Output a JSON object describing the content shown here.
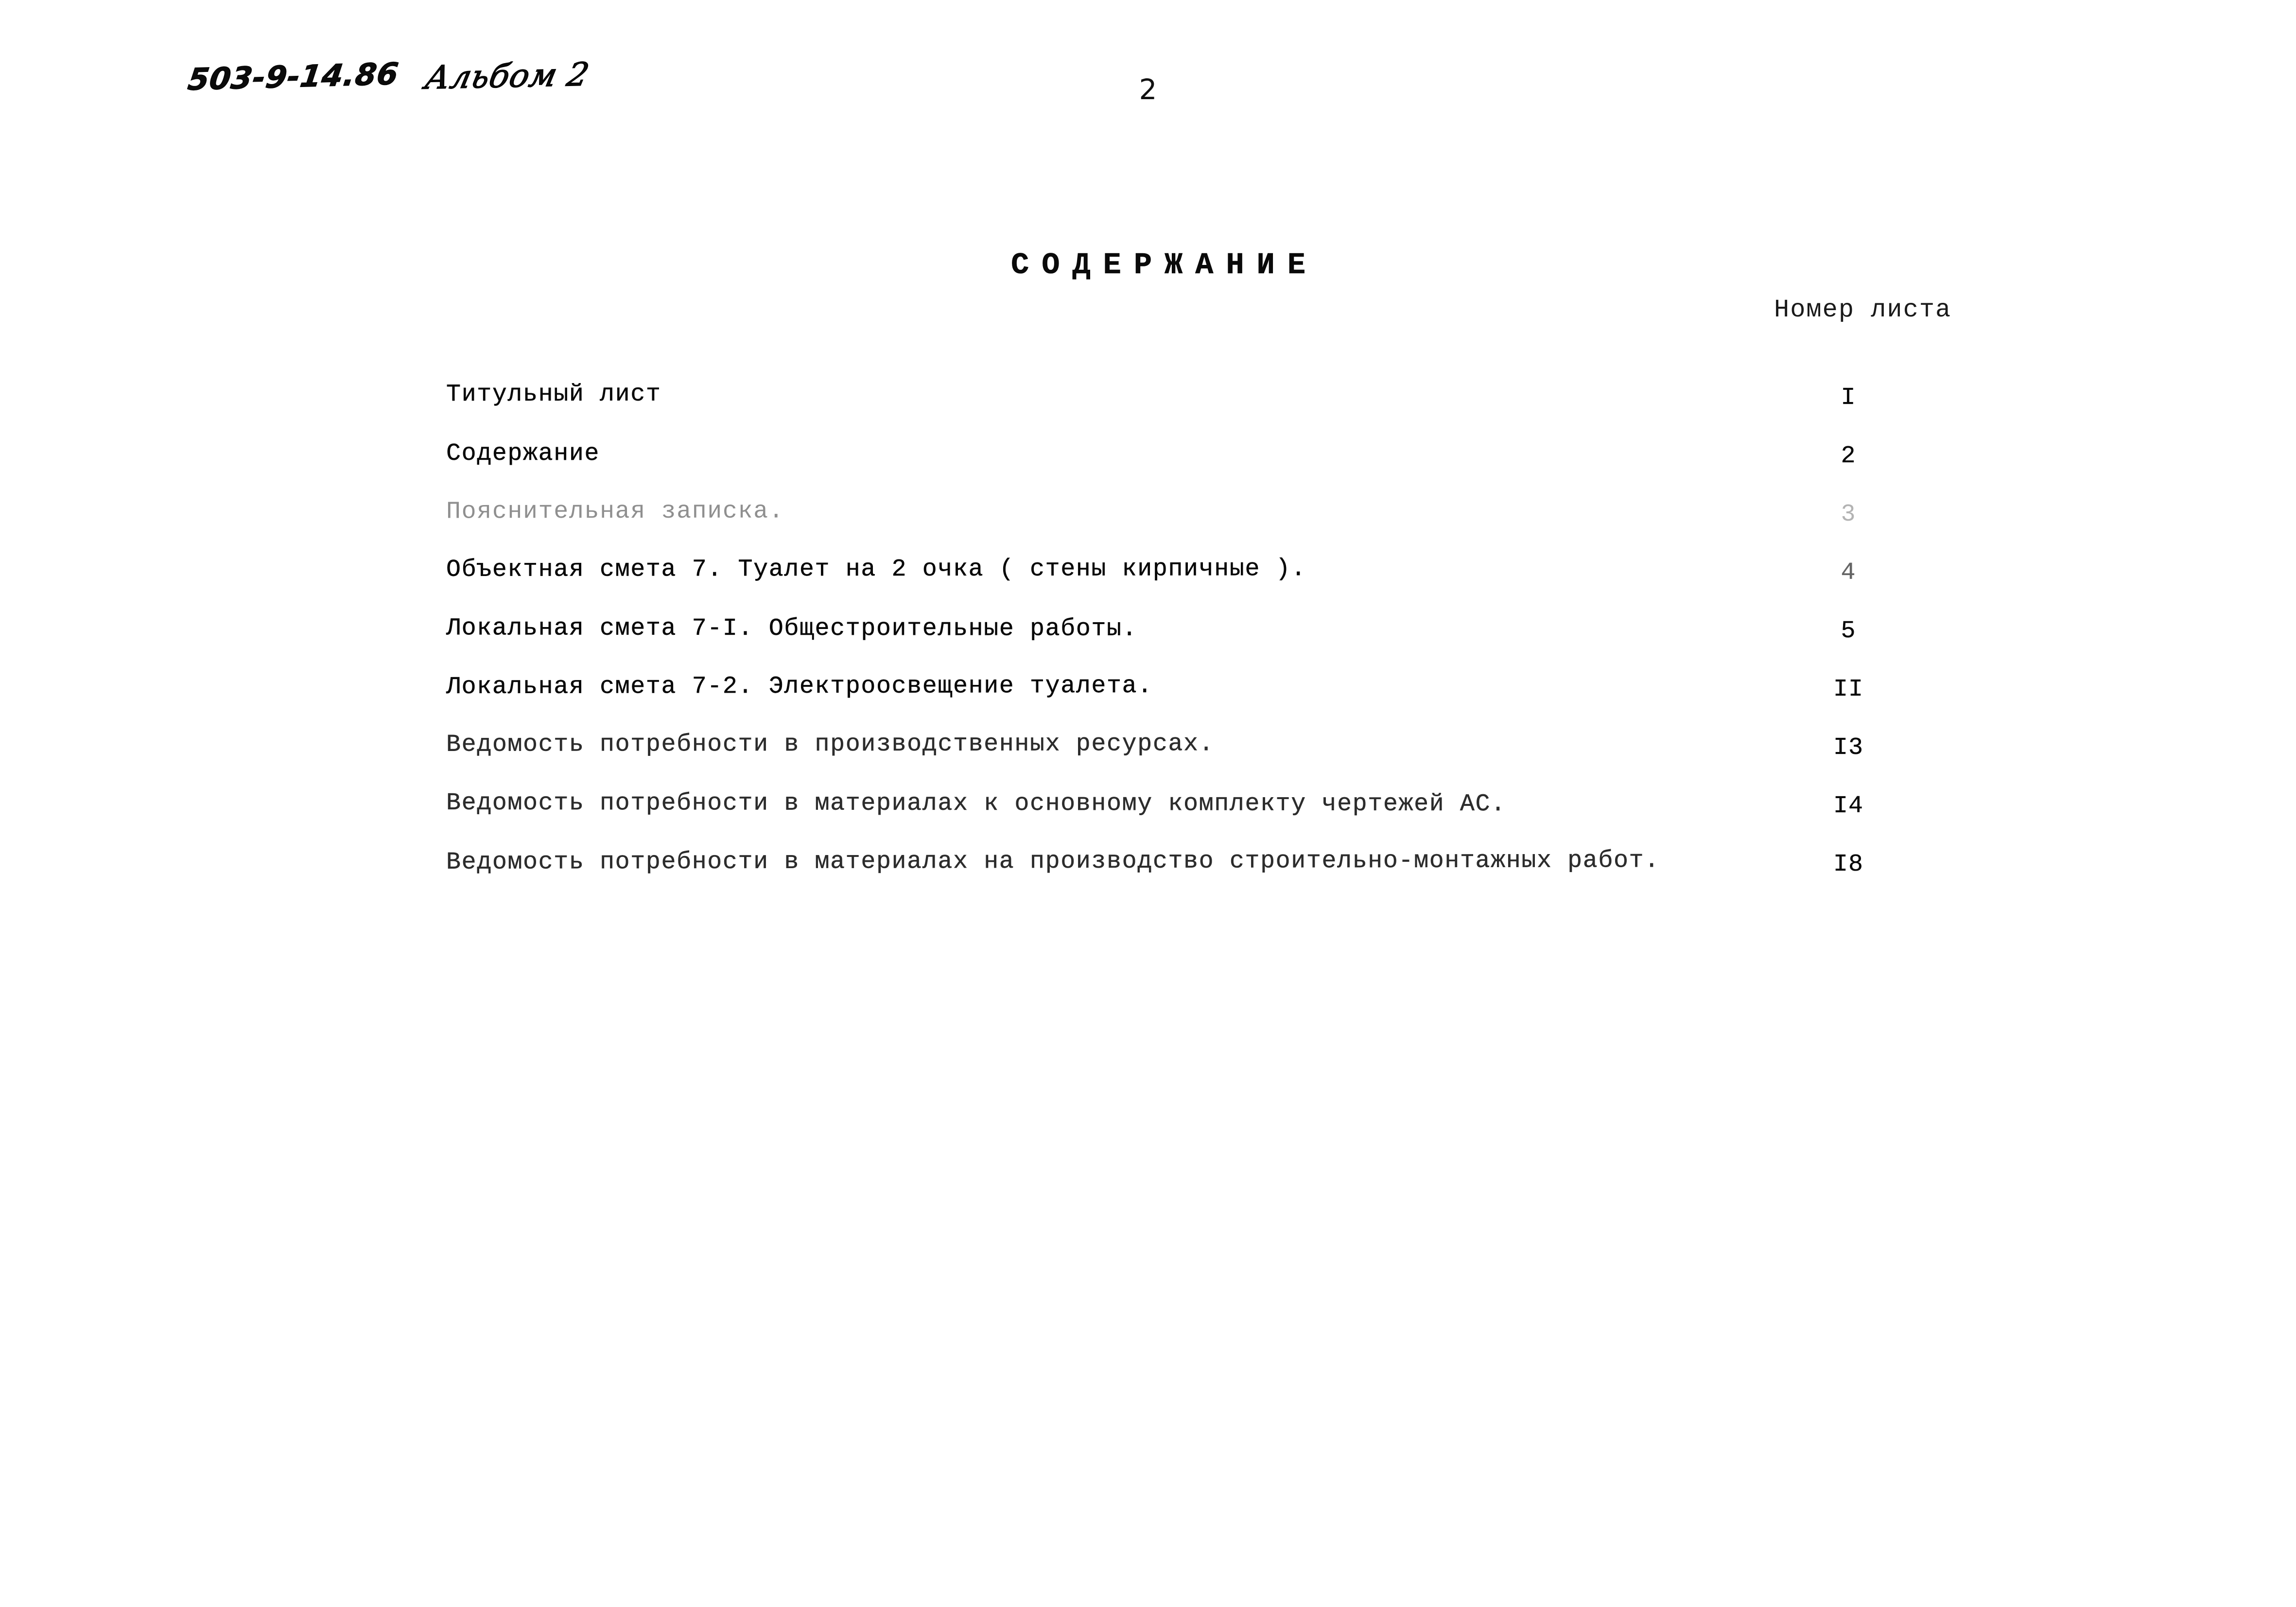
{
  "document": {
    "folio_number": "2",
    "handwritten_code": "503-9-14.86",
    "handwritten_album": "Альбом 2"
  },
  "heading": {
    "title": "СОДЕРЖАНИЕ"
  },
  "columns": {
    "page_number_header": "Номер листа"
  },
  "toc": {
    "entries": [
      {
        "label": "Титульный лист",
        "page": "I"
      },
      {
        "label": "Содержание",
        "page": "2"
      },
      {
        "label": "Пояснительная записка.",
        "page": "3"
      },
      {
        "label": "Объектная смета 7. Туалет на 2 очка ( стены кирпичные ).",
        "page": "4"
      },
      {
        "label": "Локальная смета 7-I. Общестроительные работы.",
        "page": "5"
      },
      {
        "label": "Локальная смета 7-2. Электроосвещение туалета.",
        "page": "II"
      },
      {
        "label": "Ведомость потребности в производственных ресурсах.",
        "page": "I3"
      },
      {
        "label": "Ведомость потребности в материалах к основному комплекту чертежей АС.",
        "page": "I4"
      },
      {
        "label": "Ведомость потребности в материалах на производство строительно-монтажных работ.",
        "page": "I8"
      }
    ]
  },
  "colors": {
    "paper": "#ffffff",
    "ink": "#000000"
  }
}
